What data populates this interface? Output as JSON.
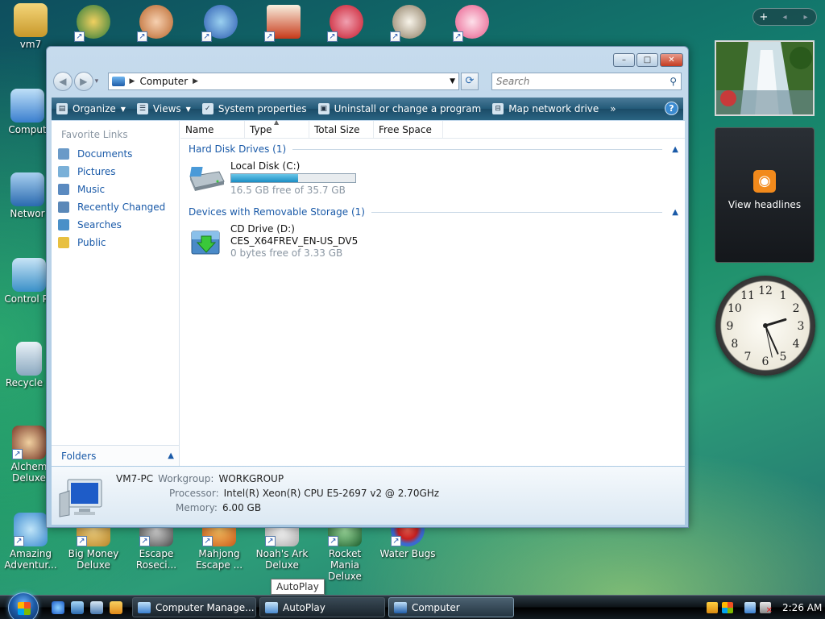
{
  "desktop": {
    "icons_left": [
      {
        "label": "vm7",
        "color": "#d9b24a"
      },
      {
        "label": "Comput",
        "color": "#4a90d9"
      },
      {
        "label": "Networ",
        "color": "#3a7fcf"
      },
      {
        "label": "Control Pa",
        "color": "#4aa0d0"
      },
      {
        "label": "Recycle B",
        "color": "#9ab0c0"
      },
      {
        "label": "Alchem\nDeluxe",
        "color": "#7a3a2a"
      }
    ],
    "icons_bottom": [
      {
        "label": "Amazing\nAdventur...",
        "color": "#3a8ad0"
      },
      {
        "label": "Big Money\nDeluxe",
        "color": "#b8862a"
      },
      {
        "label": "Escape\nRoseci...",
        "color": "#6a6a6a"
      },
      {
        "label": "Mahjong\nEscape ...",
        "color": "#c85a1a"
      },
      {
        "label": "Noah's Ark\nDeluxe",
        "color": "#d8d8d8"
      },
      {
        "label": "Rocket Mania\nDeluxe",
        "color": "#2a8a3a"
      },
      {
        "label": "Water Bugs",
        "color": "#3a6ad0"
      }
    ],
    "icons_top_colors": [
      "#2a7a3a",
      "#d89a6a",
      "#3a6ab0",
      "#c83a1a",
      "#d8283a",
      "#e8e0d0",
      "#e85a8a"
    ]
  },
  "sidebar": {
    "controls": [
      "+",
      "◂",
      "▸"
    ],
    "rss_label": "View headlines",
    "rss_color": "#f28a1c",
    "clock_numbers": [
      "12",
      "1",
      "2",
      "3",
      "4",
      "5",
      "6",
      "7",
      "8",
      "9",
      "10",
      "11"
    ]
  },
  "window": {
    "controls": {
      "minimize": "–",
      "maximize": "□",
      "close": "✕"
    },
    "address": {
      "location": "Computer"
    },
    "search_placeholder": "Search",
    "toolbar": {
      "organize": "Organize",
      "views": "Views",
      "system_properties": "System properties",
      "uninstall": "Uninstall or change a program",
      "map_drive": "Map network drive",
      "more": "»",
      "help": "?"
    },
    "favorite_links": {
      "title": "Favorite Links",
      "items": [
        {
          "label": "Documents",
          "color": "#6a9ac8"
        },
        {
          "label": "Pictures",
          "color": "#7ab0d8"
        },
        {
          "label": "Music",
          "color": "#5a8ac0"
        },
        {
          "label": "Recently Changed",
          "color": "#5a88b8"
        },
        {
          "label": "Searches",
          "color": "#4a90c8"
        },
        {
          "label": "Public",
          "color": "#e8c040"
        }
      ],
      "folders": "Folders"
    },
    "columns": [
      "Name",
      "Type",
      "Total Size",
      "Free Space"
    ],
    "groups": [
      {
        "title": "Hard Disk Drives (1)",
        "drives": [
          {
            "name": "Local Disk (C:)",
            "free_text": "16.5 GB free of 35.7 GB",
            "used_fraction": 0.54
          }
        ]
      },
      {
        "title": "Devices with Removable Storage (1)",
        "drives": [
          {
            "name": "CD Drive (D:)",
            "volume": "CES_X64FREV_EN-US_DV5",
            "free_text": "0 bytes free of 3.33 GB"
          }
        ]
      }
    ],
    "details": {
      "computer_name": "VM7-PC",
      "workgroup_label": "Workgroup:",
      "workgroup": "WORKGROUP",
      "processor_label": "Processor:",
      "processor": "Intel(R) Xeon(R) CPU E5-2697 v2 @ 2.70GHz",
      "memory_label": "Memory:",
      "memory": "6.00 GB"
    }
  },
  "tooltip": "AutoPlay",
  "taskbar": {
    "tasks": [
      {
        "label": "Computer Manage...",
        "active": false
      },
      {
        "label": "AutoPlay",
        "active": false
      },
      {
        "label": "Computer",
        "active": true
      }
    ],
    "clock": "2:26 AM"
  }
}
